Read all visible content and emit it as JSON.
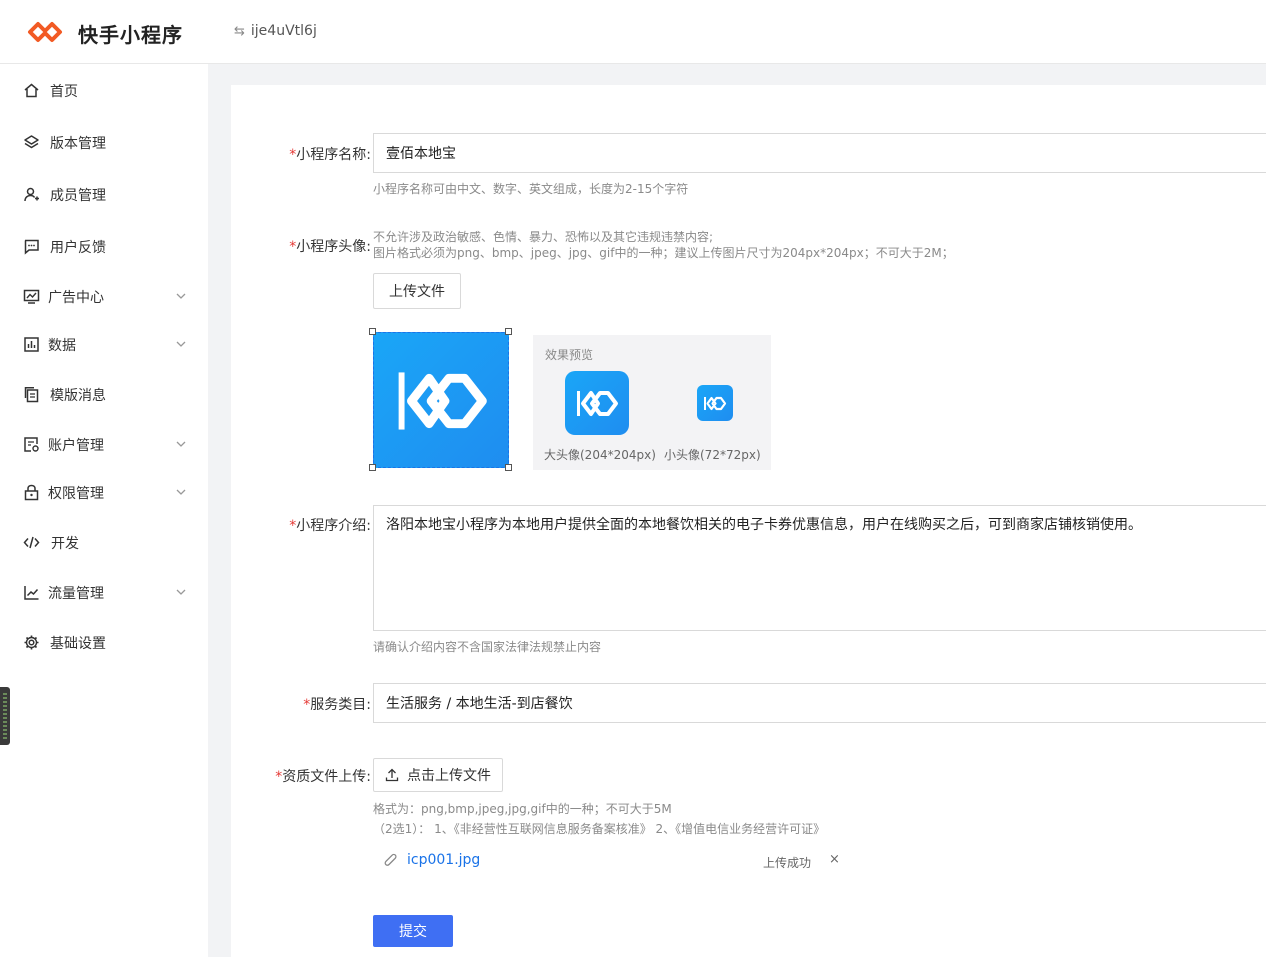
{
  "header": {
    "brand": "快手小程序",
    "app_id": "ije4uVtl6j"
  },
  "sidebar": {
    "items": [
      {
        "label": "首页",
        "icon": "home-icon"
      },
      {
        "label": "版本管理",
        "icon": "layers-icon"
      },
      {
        "label": "成员管理",
        "icon": "user-icon"
      },
      {
        "label": "用户反馈",
        "icon": "message-icon"
      },
      {
        "label": "广告中心",
        "icon": "ad-icon",
        "expandable": true
      },
      {
        "label": "数据",
        "icon": "chart-icon",
        "expandable": true
      },
      {
        "label": "模版消息",
        "icon": "copy-icon"
      },
      {
        "label": "账户管理",
        "icon": "account-icon",
        "expandable": true
      },
      {
        "label": "权限管理",
        "icon": "lock-icon",
        "expandable": true
      },
      {
        "label": "开发",
        "icon": "code-icon"
      },
      {
        "label": "流量管理",
        "icon": "trend-icon",
        "expandable": true
      },
      {
        "label": "基础设置",
        "icon": "gear-icon"
      }
    ]
  },
  "form": {
    "name": {
      "required_mark": "*",
      "label": "小程序名称:",
      "value": "壹佰本地宝",
      "hint": "小程序名称可由中文、数字、英文组成，长度为2-15个字符"
    },
    "avatar": {
      "required_mark": "*",
      "label": "小程序头像:",
      "hint_line1": "不允许涉及政治敏感、色情、暴力、恐怖以及其它违规违禁内容;",
      "hint_line2": "图片格式必须为png、bmp、jpeg、jpg、gif中的一种；建议上传图片尺寸为204px*204px；不可大于2M；",
      "upload_label": "上传文件",
      "preview_title": "效果预览",
      "big_caption": "大头像(204*204px)",
      "small_caption": "小头像(72*72px)"
    },
    "intro": {
      "required_mark": "*",
      "label": "小程序介绍:",
      "value": "洛阳本地宝小程序为本地用户提供全面的本地餐饮相关的电子卡券优惠信息，用户在线购买之后，可到商家店铺核销使用。",
      "hint": "请确认介绍内容不含国家法律法规禁止内容"
    },
    "category": {
      "required_mark": "*",
      "label": "服务类目:",
      "value": "生活服务 / 本地生活-到店餐饮"
    },
    "qualification": {
      "required_mark": "*",
      "label": "资质文件上传:",
      "upload_label": "点击上传文件",
      "hint_line1": "格式为：png,bmp,jpeg,jpg,gif中的一种；不可大于5M",
      "hint_line2": "（2选1）： 1、《非经营性互联网信息服务备案核准》 2、《增值电信业务经营许可证》",
      "file_name": "icp001.jpg",
      "file_status": "上传成功",
      "file_close": "×"
    },
    "submit_label": "提交"
  },
  "colors": {
    "primary": "#3f6ff3",
    "brand_orange": "#f25a24",
    "avatar_blue": "#1a9cf5",
    "required": "#e53935"
  }
}
